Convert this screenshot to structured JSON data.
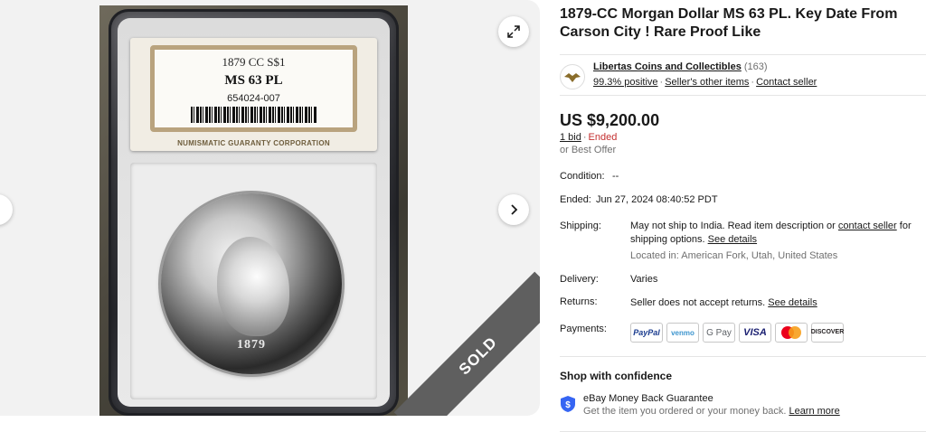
{
  "gallery": {
    "slab_label": {
      "line1": "1879 CC S$1",
      "line2": "MS 63 PL",
      "line3": "654024-007",
      "footer": "NUMISMATIC GUARANTY CORPORATION"
    },
    "coin_date": "1879",
    "ribbon": "SOLD",
    "icons": {
      "expand": "expand-icon",
      "next": "chevron-right-icon",
      "prev": "chevron-left-icon"
    }
  },
  "listing": {
    "title": "1879-CC Morgan Dollar MS 63 PL. Key Date From Carson City ! Rare Proof Like"
  },
  "seller": {
    "name": "Libertas Coins and Collectibles",
    "feedback_count": "(163)",
    "positive": "99.3% positive",
    "other_items": "Seller's other items",
    "contact": "Contact seller"
  },
  "price": {
    "amount": "US $9,200.00",
    "bids": "1 bid",
    "status": "Ended",
    "best_offer": "or Best Offer"
  },
  "details": {
    "condition_label": "Condition:",
    "condition_value": "--",
    "ended_label": "Ended:",
    "ended_value": "Jun 27, 2024 08:40:52 PDT",
    "shipping_label": "Shipping:",
    "shipping_text": "May not ship to India. Read item description or",
    "shipping_contact": "contact seller",
    "shipping_text2": "for shipping options.",
    "shipping_see": "See details",
    "located": "Located in: American Fork, Utah, United States",
    "delivery_label": "Delivery:",
    "delivery_value": "Varies",
    "returns_label": "Returns:",
    "returns_value": "Seller does not accept returns.",
    "returns_see": "See details",
    "payments_label": "Payments:"
  },
  "payments": [
    "PayPal",
    "venmo",
    "G Pay",
    "VISA",
    "mastercard",
    "DISCOVER"
  ],
  "confidence": {
    "title": "Shop with confidence",
    "guarantee": "eBay Money Back Guarantee",
    "sub": "Get the item you ordered or your money back.",
    "learn_more": "Learn more"
  },
  "colors": {
    "accent": "#3665f3",
    "ended": "#c42f2f",
    "muted": "#707070",
    "ribbon": "#5f5f5f"
  }
}
